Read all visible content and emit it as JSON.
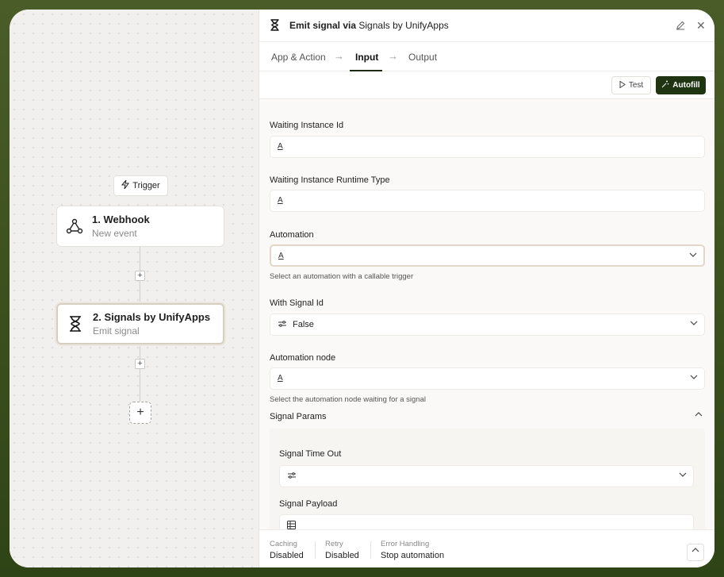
{
  "canvas": {
    "trigger_label": "Trigger",
    "nodes": [
      {
        "title": "1. Webhook",
        "subtitle": "New event",
        "icon": "webhook-icon"
      },
      {
        "title": "2. Signals by UnifyApps",
        "subtitle": "Emit signal",
        "icon": "hourglass-icon"
      }
    ],
    "add_symbol": "+"
  },
  "panel": {
    "title_bold": "Emit signal via",
    "title_rest": "Signals by UnifyApps",
    "tabs": [
      "App & Action",
      "Input",
      "Output"
    ],
    "active_tab": "Input",
    "test_label": "Test",
    "autofill_label": "Autofill",
    "fields": {
      "waiting_instance_id": {
        "label": "Waiting Instance Id",
        "value": ""
      },
      "waiting_runtime_type": {
        "label": "Waiting Instance Runtime Type",
        "value": ""
      },
      "automation": {
        "label": "Automation",
        "value": "",
        "help": "Select an automation with a callable trigger"
      },
      "with_signal_id": {
        "label": "With Signal Id",
        "value": "False"
      },
      "automation_node": {
        "label": "Automation node",
        "value": "",
        "help": "Select the automation node waiting for a signal"
      }
    },
    "signal_params": {
      "label": "Signal Params",
      "time_out_label": "Signal Time Out",
      "payload_label": "Signal Payload"
    },
    "text_icon_glyph": "A",
    "footer": [
      {
        "key": "Caching",
        "value": "Disabled"
      },
      {
        "key": "Retry",
        "value": "Disabled"
      },
      {
        "key": "Error Handling",
        "value": "Stop automation"
      }
    ]
  }
}
